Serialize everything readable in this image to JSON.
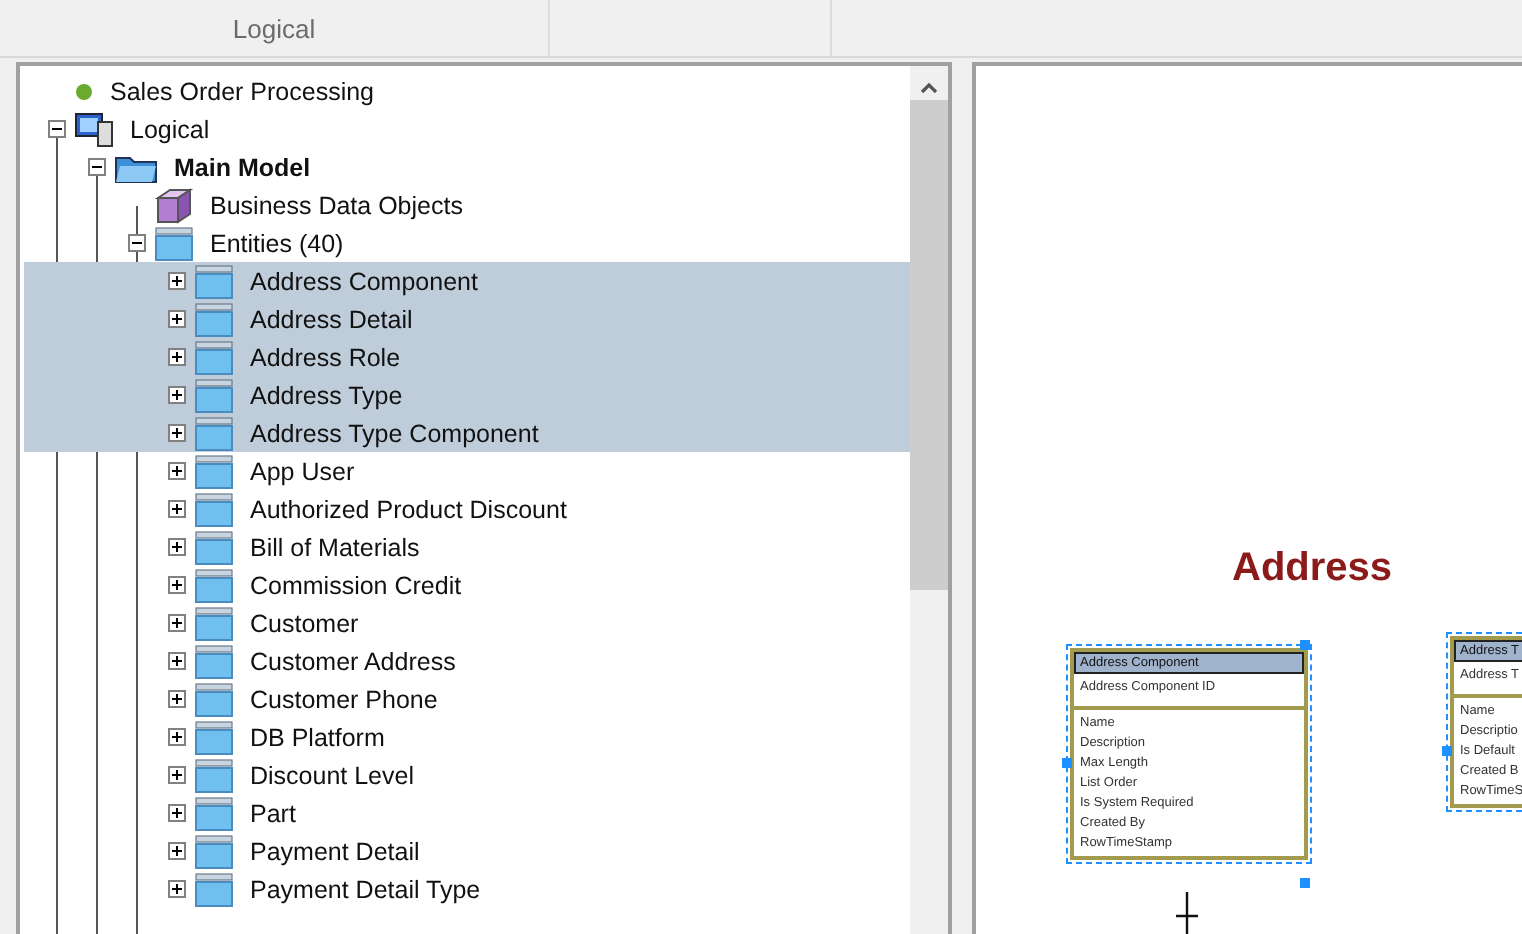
{
  "header": {
    "title": "Logical"
  },
  "tree": {
    "items": [
      {
        "label": "Sales Order Processing",
        "kind": "root",
        "selected": false,
        "children": [
          {
            "label": "Logical",
            "kind": "logical",
            "expanded": true,
            "selected": false,
            "children": [
              {
                "label": "Main Model",
                "kind": "folder",
                "expanded": true,
                "selected": false,
                "emphasis": true,
                "children": [
                  {
                    "label": "Business Data Objects",
                    "kind": "package",
                    "selected": false
                  },
                  {
                    "label": "Entities (40)",
                    "kind": "entities",
                    "expanded": true,
                    "selected": false,
                    "children": [
                      {
                        "label": "Address Component",
                        "kind": "entity",
                        "expanded": false,
                        "selected": true
                      },
                      {
                        "label": "Address Detail",
                        "kind": "entity",
                        "expanded": false,
                        "selected": true
                      },
                      {
                        "label": "Address Role",
                        "kind": "entity",
                        "expanded": false,
                        "selected": true
                      },
                      {
                        "label": "Address Type",
                        "kind": "entity",
                        "expanded": false,
                        "selected": true
                      },
                      {
                        "label": "Address Type Component",
                        "kind": "entity",
                        "expanded": false,
                        "selected": true
                      },
                      {
                        "label": "App User",
                        "kind": "entity",
                        "expanded": false,
                        "selected": false
                      },
                      {
                        "label": "Authorized Product Discount",
                        "kind": "entity",
                        "expanded": false,
                        "selected": false
                      },
                      {
                        "label": "Bill of Materials",
                        "kind": "entity",
                        "expanded": false,
                        "selected": false
                      },
                      {
                        "label": "Commission Credit",
                        "kind": "entity",
                        "expanded": false,
                        "selected": false
                      },
                      {
                        "label": "Customer",
                        "kind": "entity",
                        "expanded": false,
                        "selected": false
                      },
                      {
                        "label": "Customer Address",
                        "kind": "entity",
                        "expanded": false,
                        "selected": false
                      },
                      {
                        "label": "Customer Phone",
                        "kind": "entity",
                        "expanded": false,
                        "selected": false
                      },
                      {
                        "label": "DB Platform",
                        "kind": "entity",
                        "expanded": false,
                        "selected": false
                      },
                      {
                        "label": "Discount Level",
                        "kind": "entity",
                        "expanded": false,
                        "selected": false
                      },
                      {
                        "label": "Part",
                        "kind": "entity",
                        "expanded": false,
                        "selected": false
                      },
                      {
                        "label": "Payment Detail",
                        "kind": "entity",
                        "expanded": false,
                        "selected": false
                      },
                      {
                        "label": "Payment Detail Type",
                        "kind": "entity",
                        "expanded": false,
                        "selected": false
                      }
                    ]
                  }
                ]
              }
            ]
          }
        ]
      }
    ]
  },
  "diagram": {
    "title": "Address",
    "entities": [
      {
        "name": "Address Component",
        "selected": true,
        "keys": [
          "Address Component ID"
        ],
        "fields": [
          "Name",
          "Description",
          "Max Length",
          "List Order",
          "Is System Required",
          "Created By",
          "RowTimeStamp"
        ]
      },
      {
        "name": "Address T",
        "selected": true,
        "keys": [
          "Address T"
        ],
        "fields": [
          "Name",
          "Descriptio",
          "Is Default",
          "Created B",
          "RowTimeS"
        ]
      }
    ]
  }
}
